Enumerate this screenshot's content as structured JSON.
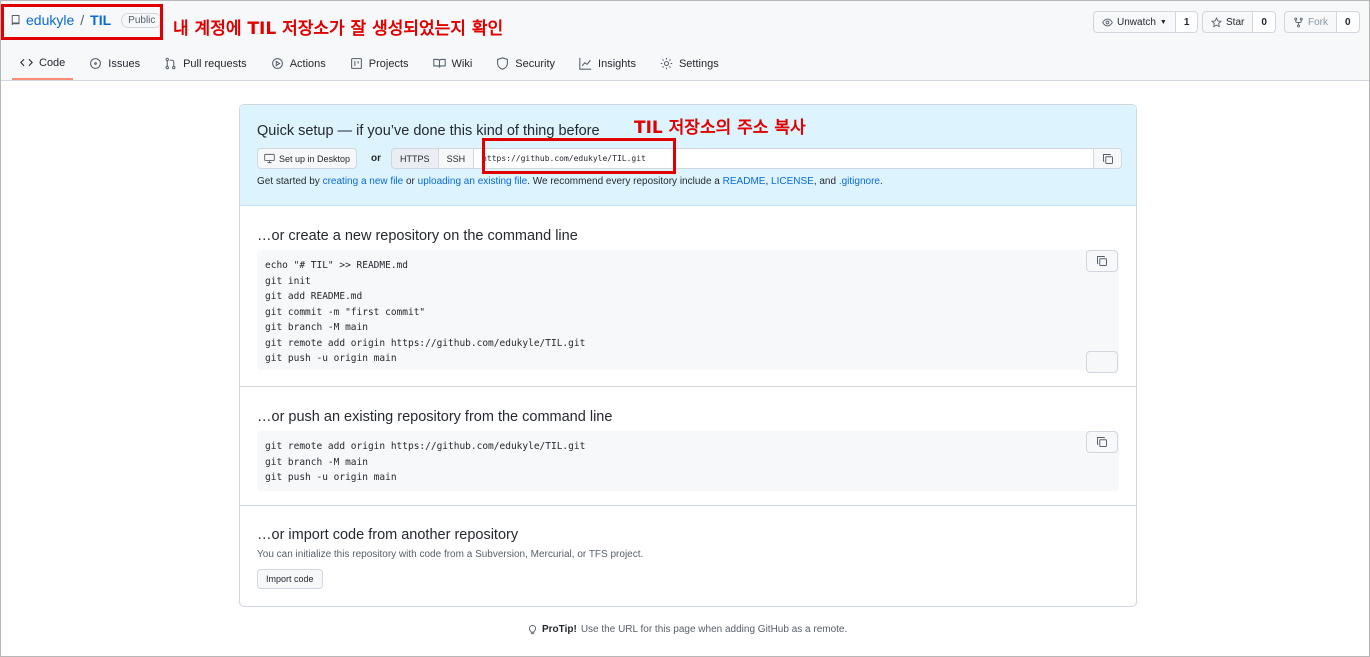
{
  "repo": {
    "owner": "edukyle",
    "separator": "/",
    "name": "TIL",
    "visibility": "Public"
  },
  "annotations": {
    "account_note": "내 계정에 TIL 저장소가 잘 생성되었는지 확인",
    "url_note": "TIL 저장소의 주소 복사",
    "color": "#e00000"
  },
  "header_actions": {
    "watch_label": "Unwatch",
    "watch_count": "1",
    "star_label": "Star",
    "star_count": "0",
    "fork_label": "Fork",
    "fork_count": "0"
  },
  "tabs": [
    {
      "label": "Code",
      "icon": "code-icon",
      "active": true
    },
    {
      "label": "Issues",
      "icon": "issue-icon"
    },
    {
      "label": "Pull requests",
      "icon": "pull-request-icon"
    },
    {
      "label": "Actions",
      "icon": "play-icon"
    },
    {
      "label": "Projects",
      "icon": "project-icon"
    },
    {
      "label": "Wiki",
      "icon": "book-icon"
    },
    {
      "label": "Security",
      "icon": "shield-icon"
    },
    {
      "label": "Insights",
      "icon": "graph-icon"
    },
    {
      "label": "Settings",
      "icon": "gear-icon"
    }
  ],
  "quick_setup": {
    "title": "Quick setup — if you’ve done this kind of thing before",
    "desktop_button": "Set up in Desktop",
    "or_label": "or",
    "https_label": "HTTPS",
    "ssh_label": "SSH",
    "url": "https://github.com/edukyle/TIL.git",
    "hint_prefix": "Get started by ",
    "hint_link1": "creating a new file",
    "hint_or": " or ",
    "hint_link2": "uploading an existing file",
    "hint_mid": ". We recommend every repository include a ",
    "hint_readme": "README",
    "hint_comma1": ", ",
    "hint_license": "LICENSE",
    "hint_comma2": ", and ",
    "hint_gitignore": ".gitignore",
    "hint_end": "."
  },
  "create_section": {
    "title": "…or create a new repository on the command line",
    "code": "echo \"# TIL\" >> README.md\ngit init\ngit add README.md\ngit commit -m \"first commit\"\ngit branch -M main\ngit remote add origin https://github.com/edukyle/TIL.git\ngit push -u origin main"
  },
  "push_section": {
    "title": "…or push an existing repository from the command line",
    "code": "git remote add origin https://github.com/edukyle/TIL.git\ngit branch -M main\ngit push -u origin main"
  },
  "import_section": {
    "title": "…or import code from another repository",
    "description": "You can initialize this repository with code from a Subversion, Mercurial, or TFS project.",
    "button": "Import code"
  },
  "protip": {
    "label": "ProTip!",
    "text": " Use the URL for this page when adding GitHub as a remote."
  }
}
